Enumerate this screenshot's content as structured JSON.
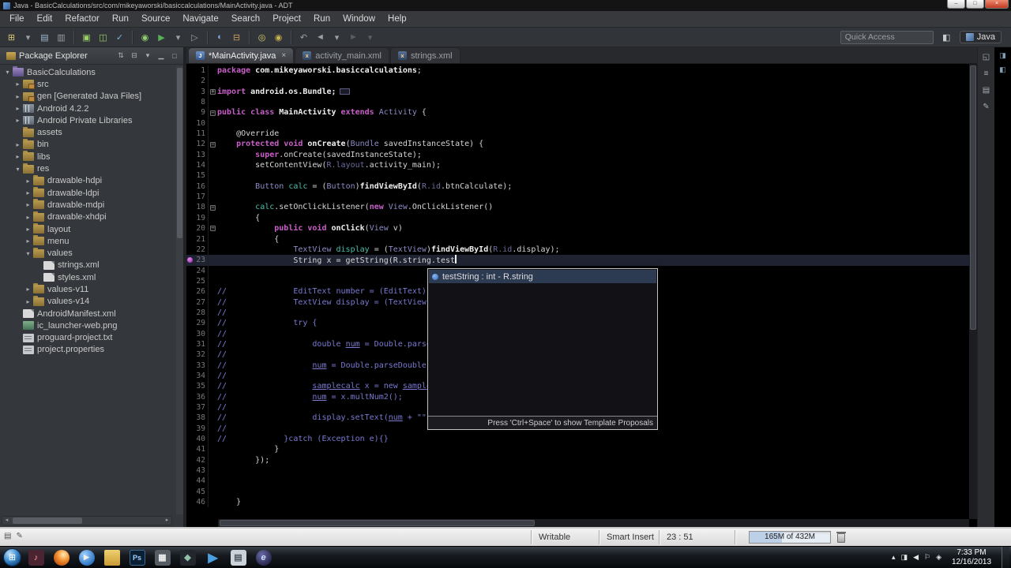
{
  "window": {
    "title": "Java - BasicCalculations/src/com/mikeyaworski/basiccalculations/MainActivity.java - ADT",
    "controls": {
      "minimize": "–",
      "maximize": "□",
      "close": "×"
    }
  },
  "menu": {
    "items": [
      "File",
      "Edit",
      "Refactor",
      "Run",
      "Source",
      "Navigate",
      "Search",
      "Project",
      "Run",
      "Window",
      "Help"
    ]
  },
  "toolbar": {
    "quick_access": "Quick Access",
    "perspective": "Java",
    "icons": [
      {
        "name": "new-wizard-icon",
        "glyph": "⊞",
        "color": "#d8c878"
      },
      {
        "name": "new-dropdown-icon",
        "glyph": "▾",
        "color": "#9aa0a6"
      },
      {
        "name": "save-icon",
        "glyph": "▤",
        "color": "#9fb9d0"
      },
      {
        "name": "print-icon",
        "glyph": "▥",
        "color": "#9aa0a6"
      },
      {
        "sep": true
      },
      {
        "name": "android-sdk-manager-icon",
        "glyph": "▣",
        "color": "#9ccf66"
      },
      {
        "name": "avd-manager-icon",
        "glyph": "◫",
        "color": "#9ccf66"
      },
      {
        "name": "lint-icon",
        "glyph": "✓",
        "color": "#76b8d8"
      },
      {
        "sep": true
      },
      {
        "name": "debug-icon",
        "glyph": "◉",
        "color": "#8fcf70"
      },
      {
        "name": "run-icon",
        "glyph": "▶",
        "color": "#58b058"
      },
      {
        "name": "run-dropdown-icon",
        "glyph": "▾",
        "color": "#9aa0a6"
      },
      {
        "name": "external-tools-icon",
        "glyph": "▷",
        "color": "#9aa0a6"
      },
      {
        "sep": true
      },
      {
        "name": "new-class-icon",
        "glyph": "◐",
        "color": "#7fa7d8"
      },
      {
        "name": "new-package-icon",
        "glyph": "⊟",
        "color": "#c8a060"
      },
      {
        "sep": true
      },
      {
        "name": "open-element-icon",
        "glyph": "◎",
        "color": "#d8cf6f"
      },
      {
        "name": "search-icon",
        "glyph": "◉",
        "color": "#c8b050"
      },
      {
        "sep": true
      },
      {
        "name": "last-edit-icon",
        "glyph": "↶",
        "color": "#9aa0a6"
      },
      {
        "name": "back-icon",
        "glyph": "◄",
        "color": "#9aa0a6"
      },
      {
        "name": "back-dropdown-icon",
        "glyph": "▾",
        "color": "#9aa0a6"
      },
      {
        "name": "forward-icon",
        "glyph": "►",
        "color": "#5a5f66"
      },
      {
        "name": "forward-dropdown-icon",
        "glyph": "▾",
        "color": "#5a5f66"
      }
    ],
    "right_icons": [
      {
        "name": "open-perspective-icon",
        "glyph": "◧"
      }
    ]
  },
  "package_explorer": {
    "title": "Package Explorer",
    "header_icons": [
      {
        "name": "focus-icon",
        "glyph": "⇅"
      },
      {
        "name": "collapse-all-icon",
        "glyph": "⊟"
      },
      {
        "name": "view-menu-icon",
        "glyph": "▾"
      },
      {
        "name": "minimize-view-icon",
        "glyph": "▁"
      },
      {
        "name": "maximize-view-icon",
        "glyph": "□"
      }
    ],
    "tree": [
      {
        "label": "BasicCalculations",
        "level": 0,
        "state": "expanded",
        "icon": "project"
      },
      {
        "label": "src",
        "level": 1,
        "state": "collapsed",
        "icon": "srcfolder"
      },
      {
        "label": "gen [Generated Java Files]",
        "level": 1,
        "state": "collapsed",
        "icon": "srcfolder"
      },
      {
        "label": "Android 4.2.2",
        "level": 1,
        "state": "collapsed",
        "icon": "library"
      },
      {
        "label": "Android Private Libraries",
        "level": 1,
        "state": "collapsed",
        "icon": "library"
      },
      {
        "label": "assets",
        "level": 1,
        "state": "none",
        "icon": "folder"
      },
      {
        "label": "bin",
        "level": 1,
        "state": "collapsed",
        "icon": "folder"
      },
      {
        "label": "libs",
        "level": 1,
        "state": "collapsed",
        "icon": "folder"
      },
      {
        "label": "res",
        "level": 1,
        "state": "expanded",
        "icon": "folder"
      },
      {
        "label": "drawable-hdpi",
        "level": 2,
        "state": "collapsed",
        "icon": "folder"
      },
      {
        "label": "drawable-ldpi",
        "level": 2,
        "state": "collapsed",
        "icon": "folder"
      },
      {
        "label": "drawable-mdpi",
        "level": 2,
        "state": "collapsed",
        "icon": "folder"
      },
      {
        "label": "drawable-xhdpi",
        "level": 2,
        "state": "collapsed",
        "icon": "folder"
      },
      {
        "label": "layout",
        "level": 2,
        "state": "collapsed",
        "icon": "folder"
      },
      {
        "label": "menu",
        "level": 2,
        "state": "collapsed",
        "icon": "folder"
      },
      {
        "label": "values",
        "level": 2,
        "state": "expanded",
        "icon": "folder"
      },
      {
        "label": "strings.xml",
        "level": 3,
        "state": "none",
        "icon": "xml"
      },
      {
        "label": "styles.xml",
        "level": 3,
        "state": "none",
        "icon": "xml"
      },
      {
        "label": "values-v11",
        "level": 2,
        "state": "collapsed",
        "icon": "folder"
      },
      {
        "label": "values-v14",
        "level": 2,
        "state": "collapsed",
        "icon": "folder"
      },
      {
        "label": "AndroidManifest.xml",
        "level": 1,
        "state": "none",
        "icon": "xml"
      },
      {
        "label": "ic_launcher-web.png",
        "level": 1,
        "state": "none",
        "icon": "image"
      },
      {
        "label": "proguard-project.txt",
        "level": 1,
        "state": "none",
        "icon": "text"
      },
      {
        "label": "project.properties",
        "level": 1,
        "state": "none",
        "icon": "text"
      }
    ]
  },
  "editor": {
    "tabs": [
      {
        "label": "*MainActivity.java",
        "icon": "java",
        "active": true
      },
      {
        "label": "activity_main.xml",
        "icon": "xml",
        "active": false
      },
      {
        "label": "strings.xml",
        "icon": "xml",
        "active": false
      }
    ],
    "breakpoint_line": 23,
    "current_line": 23,
    "lines": [
      {
        "n": 1,
        "tokens": [
          [
            "k",
            "package"
          ],
          [
            "b",
            " com.mikeyaworski.basiccalculations"
          ],
          [
            "p",
            ";"
          ]
        ]
      },
      {
        "n": 2,
        "tokens": []
      },
      {
        "n": 3,
        "fold": "+",
        "tokens": [
          [
            "k",
            "import"
          ],
          [
            "b",
            " android.os.Bundle;"
          ],
          [
            "box",
            ""
          ]
        ]
      },
      {
        "n": 8,
        "tokens": []
      },
      {
        "n": 9,
        "fold": "-",
        "tokens": [
          [
            "k",
            "public class"
          ],
          [
            "b",
            " MainActivity "
          ],
          [
            "k",
            "extends"
          ],
          [
            "t",
            " Activity "
          ],
          [
            "p",
            "{"
          ]
        ]
      },
      {
        "n": 10,
        "tokens": []
      },
      {
        "n": 11,
        "tokens": [
          [
            "p",
            "    @Override"
          ]
        ]
      },
      {
        "n": 12,
        "fold": "-",
        "tokens": [
          [
            "p",
            "    "
          ],
          [
            "k",
            "protected void"
          ],
          [
            "b",
            " onCreate"
          ],
          [
            "p",
            "("
          ],
          [
            "t",
            "Bundle"
          ],
          [
            "p",
            " savedInstanceState) {"
          ]
        ]
      },
      {
        "n": 13,
        "tokens": [
          [
            "p",
            "        "
          ],
          [
            "k",
            "super"
          ],
          [
            "p",
            ".onCreate(savedInstanceState);"
          ]
        ]
      },
      {
        "n": 14,
        "tokens": [
          [
            "p",
            "        setContentView("
          ],
          [
            "r",
            "R.layout"
          ],
          [
            "p",
            ".activity_main);"
          ]
        ]
      },
      {
        "n": 15,
        "tokens": []
      },
      {
        "n": 16,
        "tokens": [
          [
            "p",
            "        "
          ],
          [
            "t",
            "Button"
          ],
          [
            "v",
            " calc"
          ],
          [
            "p",
            " = ("
          ],
          [
            "t",
            "Button"
          ],
          [
            "p",
            ")"
          ],
          [
            "b",
            "findViewById"
          ],
          [
            "p",
            "("
          ],
          [
            "r",
            "R.id"
          ],
          [
            "p",
            ".btnCalculate);"
          ]
        ]
      },
      {
        "n": 17,
        "tokens": []
      },
      {
        "n": 18,
        "fold": "-",
        "tokens": [
          [
            "p",
            "        "
          ],
          [
            "v",
            "calc"
          ],
          [
            "p",
            ".setOnClickListener("
          ],
          [
            "k",
            "new"
          ],
          [
            "p",
            " "
          ],
          [
            "t",
            "View"
          ],
          [
            "p",
            ".OnClickListener()"
          ]
        ]
      },
      {
        "n": 19,
        "tokens": [
          [
            "p",
            "        {"
          ]
        ]
      },
      {
        "n": 20,
        "fold": "-",
        "tokens": [
          [
            "p",
            "            "
          ],
          [
            "k",
            "public void"
          ],
          [
            "b",
            " onClick"
          ],
          [
            "p",
            "("
          ],
          [
            "t",
            "View"
          ],
          [
            "p",
            " v)"
          ]
        ]
      },
      {
        "n": 21,
        "tokens": [
          [
            "p",
            "            {"
          ]
        ]
      },
      {
        "n": 22,
        "tokens": [
          [
            "p",
            "                "
          ],
          [
            "t",
            "TextView"
          ],
          [
            "v",
            " display"
          ],
          [
            "p",
            " = ("
          ],
          [
            "t",
            "TextView"
          ],
          [
            "p",
            ")"
          ],
          [
            "b",
            "findViewById"
          ],
          [
            "p",
            "("
          ],
          [
            "r",
            "R.id"
          ],
          [
            "p",
            ".display);"
          ]
        ]
      },
      {
        "n": 23,
        "caret": true,
        "tokens": [
          [
            "p",
            "                String x = getString(R.string.test"
          ]
        ]
      },
      {
        "n": 24,
        "tokens": []
      },
      {
        "n": 25,
        "tokens": []
      },
      {
        "n": 26,
        "tokens": [
          [
            "c",
            "//              EditText number = (EditText)fi"
          ]
        ]
      },
      {
        "n": 27,
        "tokens": [
          [
            "c",
            "//              TextView display = (TextView)fi"
          ]
        ]
      },
      {
        "n": 28,
        "tokens": [
          [
            "c",
            "//"
          ]
        ]
      },
      {
        "n": 29,
        "tokens": [
          [
            "c",
            "//              try {"
          ]
        ]
      },
      {
        "n": 30,
        "tokens": [
          [
            "c",
            "//"
          ]
        ]
      },
      {
        "n": 31,
        "tokens": [
          [
            "c",
            "//                  double "
          ],
          [
            "cu",
            "num"
          ],
          [
            "c",
            " = Double.parseD"
          ]
        ]
      },
      {
        "n": 32,
        "tokens": [
          [
            "c",
            "//"
          ]
        ]
      },
      {
        "n": 33,
        "tokens": [
          [
            "c",
            "//                  "
          ],
          [
            "cu",
            "num"
          ],
          [
            "c",
            " = Double.parseDouble(s"
          ]
        ]
      },
      {
        "n": 34,
        "tokens": [
          [
            "c",
            "//"
          ]
        ]
      },
      {
        "n": 35,
        "tokens": [
          [
            "c",
            "//                  "
          ],
          [
            "cu",
            "samplecalc"
          ],
          [
            "c",
            " x = new "
          ],
          [
            "cu",
            "samplec"
          ]
        ]
      },
      {
        "n": 36,
        "tokens": [
          [
            "c",
            "//                  "
          ],
          [
            "cu",
            "num"
          ],
          [
            "c",
            " = x.multNum2();"
          ]
        ]
      },
      {
        "n": 37,
        "tokens": [
          [
            "c",
            "//"
          ]
        ]
      },
      {
        "n": 38,
        "tokens": [
          [
            "c",
            "//                  display.setText("
          ],
          [
            "cu",
            "num"
          ],
          [
            "c",
            " + \"\")"
          ]
        ]
      },
      {
        "n": 39,
        "tokens": [
          [
            "c",
            "//"
          ]
        ]
      },
      {
        "n": 40,
        "tokens": [
          [
            "c",
            "//            }catch (Exception e){}"
          ]
        ]
      },
      {
        "n": 41,
        "tokens": [
          [
            "p",
            "            }"
          ]
        ]
      },
      {
        "n": 42,
        "tokens": [
          [
            "p",
            "        });"
          ]
        ]
      },
      {
        "n": 43,
        "tokens": []
      },
      {
        "n": 44,
        "tokens": []
      },
      {
        "n": 45,
        "tokens": []
      },
      {
        "n": 46,
        "tokens": [
          [
            "p",
            "    }"
          ]
        ]
      }
    ]
  },
  "autocomplete": {
    "items": [
      {
        "label": "testString : int - R.string"
      }
    ],
    "footer": "Press 'Ctrl+Space' to show Template Proposals"
  },
  "right_rail": {
    "icons": [
      {
        "name": "restore-view-icon",
        "glyph": "◱"
      },
      {
        "name": "outline-view-icon",
        "glyph": "≡"
      },
      {
        "name": "task-list-icon",
        "glyph": "▤"
      },
      {
        "name": "templates-view-icon",
        "glyph": "✎"
      }
    ]
  },
  "edge_strip": {
    "icons": [
      {
        "name": "editor-list-icon",
        "glyph": "◨"
      },
      {
        "name": "split-editor-icon",
        "glyph": "◧"
      }
    ]
  },
  "status_bar": {
    "left_icons": [
      {
        "name": "lock-status-icon",
        "glyph": "▤"
      },
      {
        "name": "caret-mode-icon",
        "glyph": "✎"
      }
    ],
    "writable": "Writable",
    "insert_mode": "Smart Insert",
    "position": "23 : 51",
    "heap": "165M of 432M"
  },
  "taskbar": {
    "start": {
      "name": "start-button",
      "glyph": "⊞"
    },
    "apps": [
      {
        "name": "taskbar-media-icon",
        "glyph": "♪"
      },
      {
        "name": "taskbar-firefox-icon",
        "glyph": ""
      },
      {
        "name": "taskbar-wmp-icon",
        "glyph": "▶"
      },
      {
        "name": "taskbar-folder-icon",
        "glyph": ""
      },
      {
        "name": "taskbar-photoshop-icon",
        "glyph": "Ps"
      },
      {
        "name": "taskbar-tools-icon",
        "glyph": "▦"
      },
      {
        "name": "taskbar-console-icon",
        "glyph": "◆"
      },
      {
        "name": "taskbar-player-icon",
        "glyph": "▶"
      },
      {
        "name": "taskbar-notes-icon",
        "glyph": "▤"
      },
      {
        "name": "taskbar-eclipse-icon",
        "glyph": "e"
      }
    ],
    "tray": [
      {
        "name": "show-hidden-icon",
        "glyph": "▴"
      },
      {
        "name": "network-icon",
        "glyph": "◨"
      },
      {
        "name": "volume-icon",
        "glyph": "◀"
      },
      {
        "name": "flag-icon",
        "glyph": "⚐"
      },
      {
        "name": "device-icon",
        "glyph": "◈"
      }
    ],
    "clock_time": "7:33 PM",
    "clock_date": "12/16/2013"
  }
}
